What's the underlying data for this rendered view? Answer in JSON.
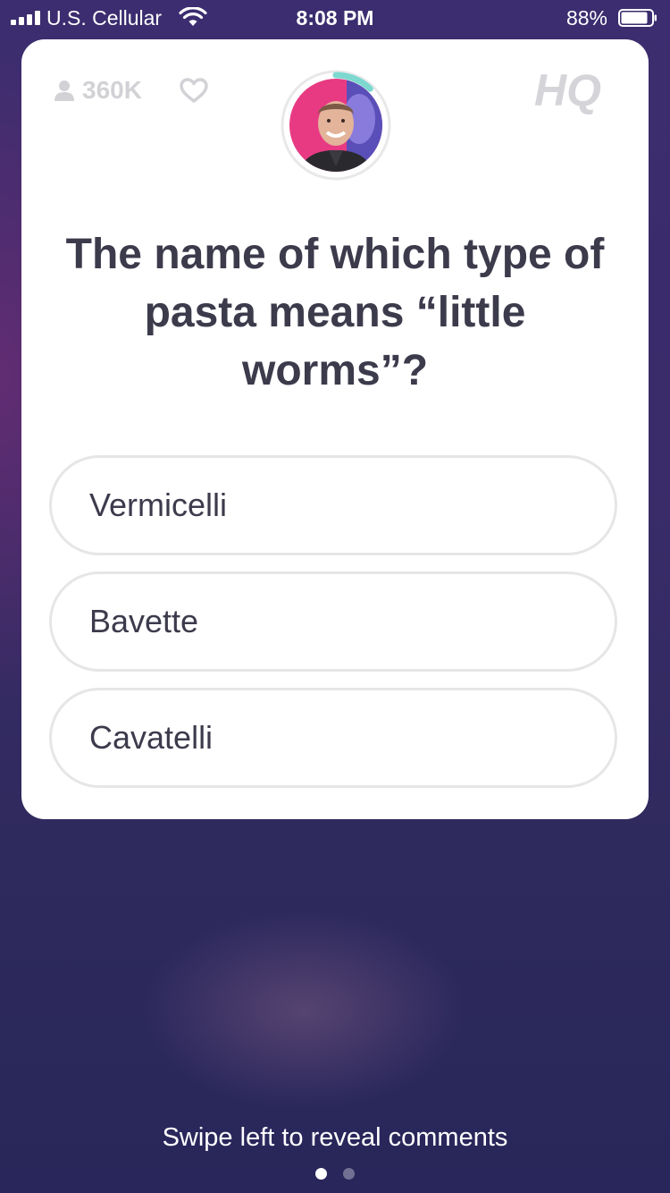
{
  "status_bar": {
    "carrier": "U.S. Cellular",
    "time": "8:08 PM",
    "battery_percent": "88%",
    "battery_level": 0.88,
    "signal_icon": "cellular-signal-icon",
    "wifi_icon": "wifi-icon",
    "battery_icon": "battery-icon"
  },
  "game": {
    "viewer_count": "360K",
    "viewer_icon": "user-icon",
    "like_icon": "heart-icon",
    "logo_text": "HQ",
    "host_icon": "host-avatar",
    "question": "The name of which type of pasta means “little worms”?",
    "answers": [
      {
        "label": "Vermicelli"
      },
      {
        "label": "Bavette"
      },
      {
        "label": "Cavatelli"
      }
    ],
    "timer_progress": 0.12
  },
  "colors": {
    "timer_accent": "#7dd8cf",
    "avatar_background": "#e83a83",
    "text_dark": "#3c3b4c",
    "muted_gray": "#d2d2d6"
  },
  "footer": {
    "hint": "Swipe left to reveal comments",
    "pages": 2,
    "active_page": 1
  }
}
